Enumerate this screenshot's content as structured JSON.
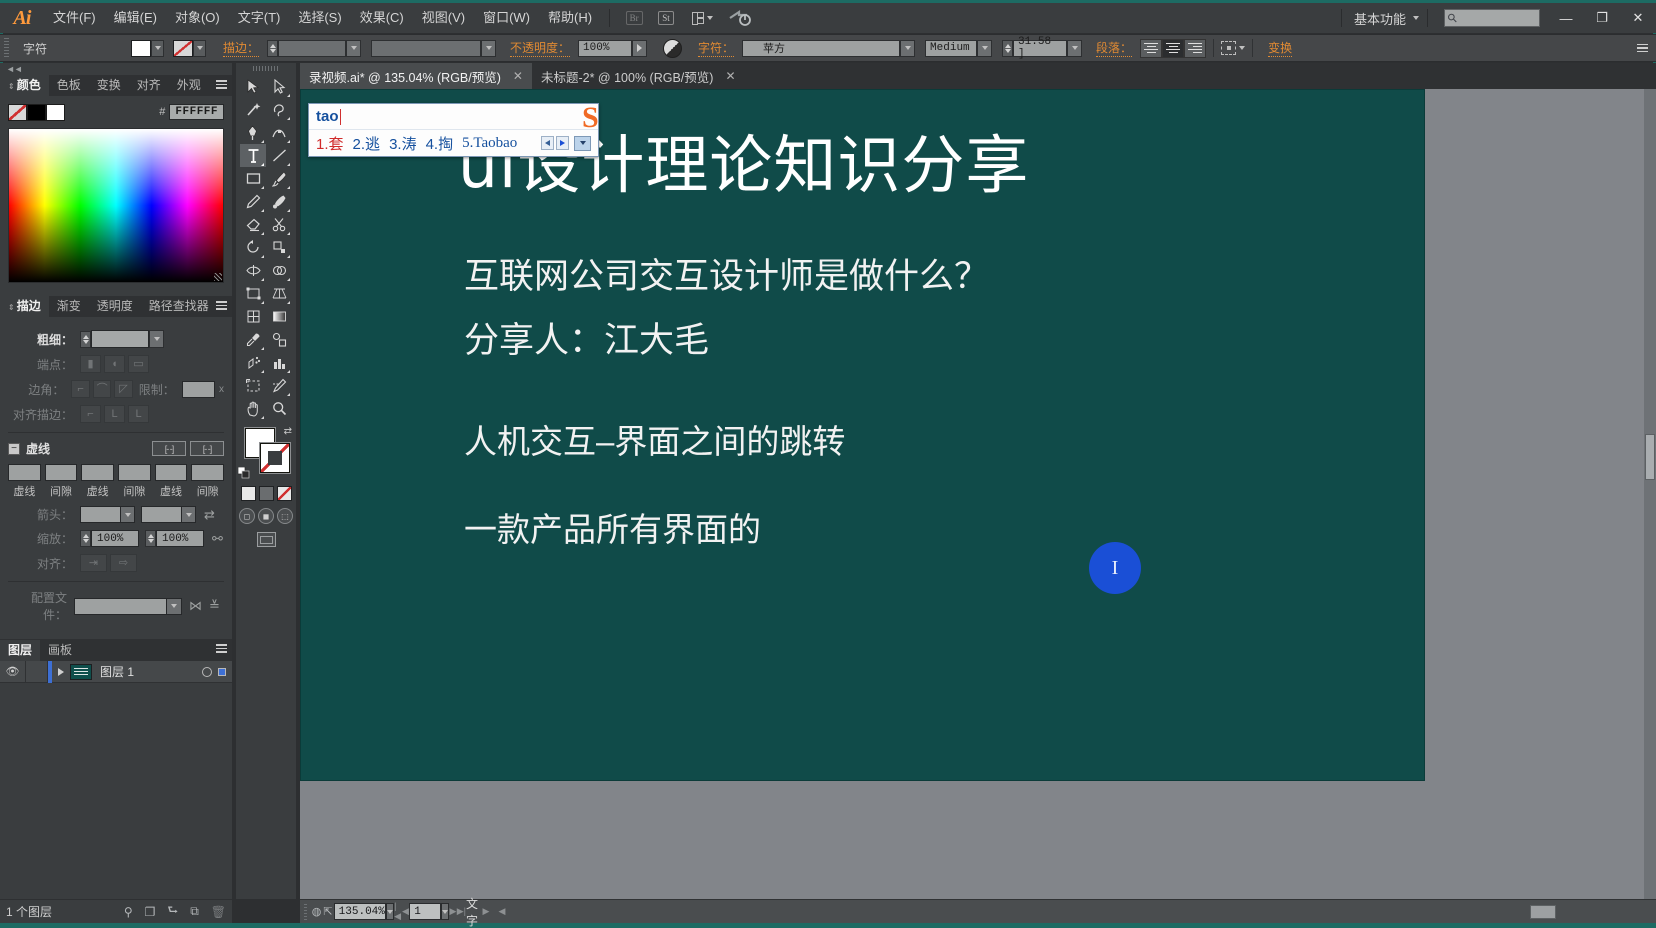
{
  "app": {
    "name": "Adobe Illustrator",
    "logo": "Ai"
  },
  "menubar": {
    "items": [
      "文件(F)",
      "编辑(E)",
      "对象(O)",
      "文字(T)",
      "选择(S)",
      "效果(C)",
      "视图(V)",
      "窗口(W)",
      "帮助(H)"
    ],
    "bridge_label": "Br",
    "stock_label": "St",
    "arrange_label": "排列文档",
    "cc_label": "Adobe CC",
    "workspace": "基本功能",
    "search_placeholder": "",
    "window_buttons": {
      "minimize": "—",
      "maximize": "❐",
      "close": "✕"
    }
  },
  "controlbar": {
    "title": "字符",
    "fill_swatch": "#FFFFFF",
    "stroke_swatch": "none",
    "stroke_label": "描边：",
    "stroke_weight": "",
    "stroke_profile": "",
    "opacity_label": "不透明度：",
    "opacity_value": "100%",
    "char_label": "字符：",
    "font_family": "苹方",
    "font_style": "Medium",
    "font_size": "31.58 ]",
    "paragraph_label": "段落：",
    "transform_label": "变换"
  },
  "color_panel": {
    "tabs": [
      "颜色",
      "色板",
      "变换",
      "对齐",
      "外观"
    ],
    "active_tab": "颜色",
    "hash": "#",
    "hex_value": "FFFFFF"
  },
  "stroke_panel": {
    "tabs": [
      "描边",
      "渐变",
      "透明度",
      "路径查找器"
    ],
    "active_tab": "描边",
    "weight_label": "粗细：",
    "weight_value": "",
    "cap_label": "端点：",
    "corner_label": "边角：",
    "limit_label": "限制：",
    "limit_value": "",
    "limit_unit": "x",
    "align_label": "对齐描边：",
    "dash_toggle": "−",
    "dash_title": "虚线",
    "dash_fields": [
      "",
      "",
      "",
      "",
      "",
      ""
    ],
    "dash_labels": [
      "虚线",
      "间隙",
      "虚线",
      "间隙",
      "虚线",
      "间隙"
    ],
    "arrow_label": "箭头：",
    "arrow_start": "",
    "arrow_end": "",
    "scale_label": "缩放：",
    "scale_start": "100%",
    "scale_end": "100%",
    "align_arrow_label": "对齐：",
    "profile_label": "配置文件：",
    "profile_value": ""
  },
  "layers_panel": {
    "tabs": [
      "图层",
      "画板"
    ],
    "active_tab": "图层",
    "rows": [
      {
        "name": "图层 1"
      }
    ],
    "status": "1 个图层"
  },
  "toolbox": {
    "tools": [
      "selection-tool",
      "direct-selection-tool",
      "magic-wand-tool",
      "lasso-tool",
      "pen-tool",
      "add-anchor-point-tool",
      "type-tool",
      "line-segment-tool",
      "rectangle-tool",
      "ellipse-tool",
      "paintbrush-tool",
      "pencil-tool",
      "blob-brush-tool",
      "eraser-tool",
      "rotate-tool",
      "scale-tool",
      "width-tool",
      "free-transform-tool",
      "shape-builder-tool",
      "perspective-grid-tool",
      "mesh-tool",
      "gradient-tool",
      "eyedropper-tool",
      "blend-tool",
      "symbol-sprayer-tool",
      "column-graph-tool",
      "artboard-tool",
      "slice-tool",
      "hand-tool",
      "zoom-tool"
    ],
    "selected_tool": "type-tool",
    "fill_color": "#FFFFFF",
    "stroke_color": "none",
    "screen_mode": "normal-screen-mode"
  },
  "documents": {
    "tabs": [
      {
        "label": "录视频.ai* @ 135.04% (RGB/预览)",
        "active": true,
        "close": "✕"
      },
      {
        "label": "未标题-2* @ 100% (RGB/预览)",
        "active": false,
        "close": "✕"
      }
    ]
  },
  "ime": {
    "composition": "tao",
    "candidates": [
      {
        "index": "1.",
        "text": "套",
        "first": true
      },
      {
        "index": "2.",
        "text": "逃",
        "first": false
      },
      {
        "index": "3.",
        "text": "涛",
        "first": false
      },
      {
        "index": "4.",
        "text": "掏",
        "first": false
      },
      {
        "index": "5.",
        "text": "Taobao",
        "first": false,
        "latin": true
      }
    ],
    "logo": "S"
  },
  "canvas": {
    "background_color": "#104b49",
    "slide": {
      "title": "ui设计理论知识分享",
      "line1": "互联网公司交互设计师是做什么？",
      "line2": "分享人：江大毛",
      "line3": "人机交互–界面之间的跳转",
      "line4": "一款产品所有界面的"
    },
    "cursor_badge": "I"
  },
  "statusbar": {
    "zoom": "135.04%",
    "page": "1",
    "status_text": "文字"
  }
}
